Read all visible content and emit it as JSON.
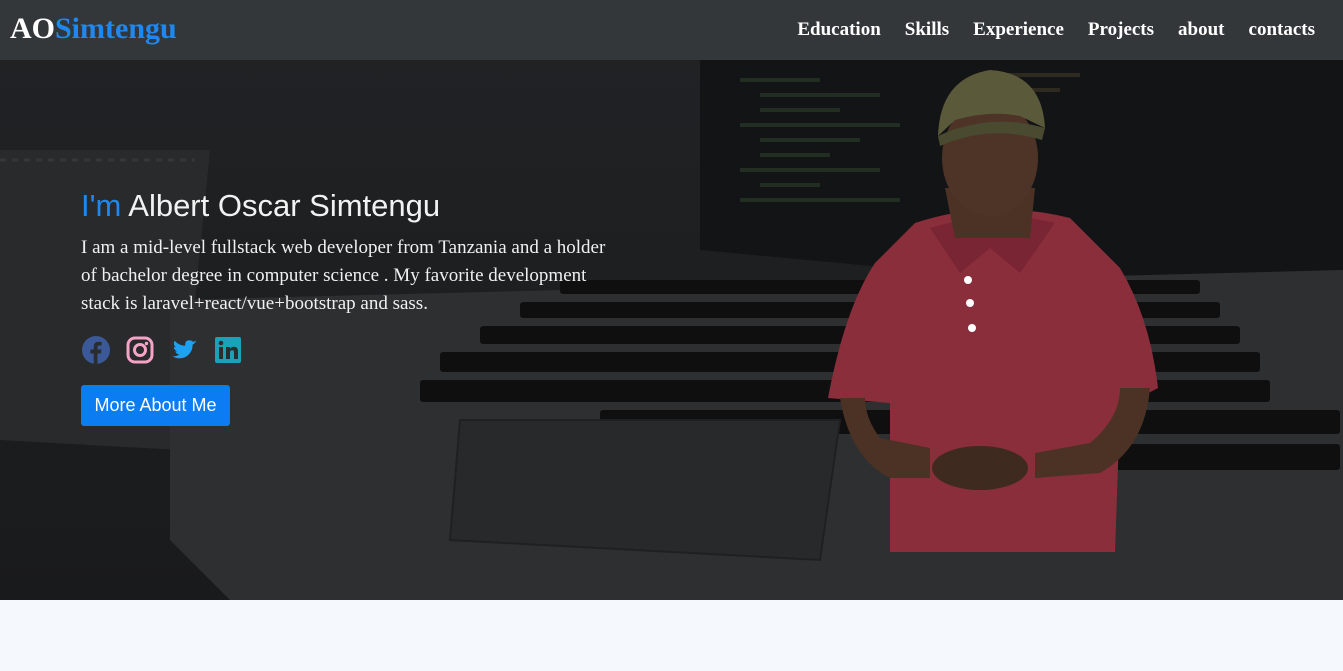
{
  "brand": {
    "first": "AO",
    "second": "Simtengu"
  },
  "nav": {
    "items": [
      {
        "label": "Education"
      },
      {
        "label": "Skills"
      },
      {
        "label": "Experience"
      },
      {
        "label": "Projects"
      },
      {
        "label": "about"
      },
      {
        "label": "contacts"
      }
    ]
  },
  "hero": {
    "prefix": "I'm",
    "name": "Albert Oscar Simtengu",
    "bio": "I am a mid-level fullstack web developer from Tanzania and a holder of bachelor degree in computer science . My favorite development stack is laravel+react/vue+bootstrap and sass.",
    "cta_label": "More About Me"
  },
  "socials": [
    {
      "icon": "facebook-icon",
      "color": "#3b5998"
    },
    {
      "icon": "instagram-icon",
      "color": "#f5a3c7"
    },
    {
      "icon": "twitter-icon",
      "color": "#1da1f2"
    },
    {
      "icon": "linkedin-icon",
      "color": "#1aa3b8"
    }
  ],
  "colors": {
    "accent": "#1e88f0",
    "button": "#0b7cf2",
    "nav_bg": "#3a3d40"
  }
}
